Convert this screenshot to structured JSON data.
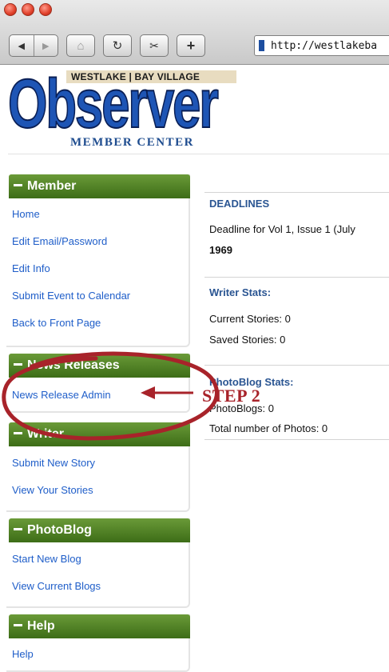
{
  "browser": {
    "url": "http://westlakeba",
    "icons": [
      "back-icon",
      "forward-icon",
      "home-icon",
      "reload-icon",
      "snippet-icon",
      "add-bookmark-icon"
    ]
  },
  "logo": {
    "tagline": "WESTLAKE | BAY VILLAGE",
    "wordmark": "Observer",
    "subtitle": "MEMBER CENTER"
  },
  "sidebar": {
    "member": {
      "title": "Member",
      "items": [
        "Home",
        "Edit Email/Password",
        "Edit Info",
        "Submit Event to Calendar",
        "Back to Front Page"
      ]
    },
    "news": {
      "title": "News Releases",
      "items": [
        "News Release Admin"
      ]
    },
    "writer": {
      "title": "Writer",
      "items": [
        "Submit New Story",
        "View Your Stories"
      ]
    },
    "photoblog": {
      "title": "PhotoBlog",
      "items": [
        "Start New Blog",
        "View Current Blogs"
      ]
    },
    "help": {
      "title": "Help",
      "items": [
        "Help"
      ]
    }
  },
  "main": {
    "deadlines": {
      "title": "DEADLINES",
      "text": "Deadline for Vol 1, Issue 1 (July",
      "year": "1969"
    },
    "writer_stats": {
      "title": "Writer Stats:",
      "current": "Current Stories: 0",
      "saved": "Saved Stories: 0"
    },
    "photoblog_stats": {
      "title": "PhotoBlog Stats:",
      "blogs": "PhotoBlogs: 0",
      "photos": "Total number of Photos: 0"
    }
  },
  "annotation": {
    "label": "STEP 2",
    "color": "#a8232a"
  },
  "colors": {
    "link": "#1f5ec9",
    "header_green": "#4f7f25",
    "heading_blue": "#2a5592"
  }
}
